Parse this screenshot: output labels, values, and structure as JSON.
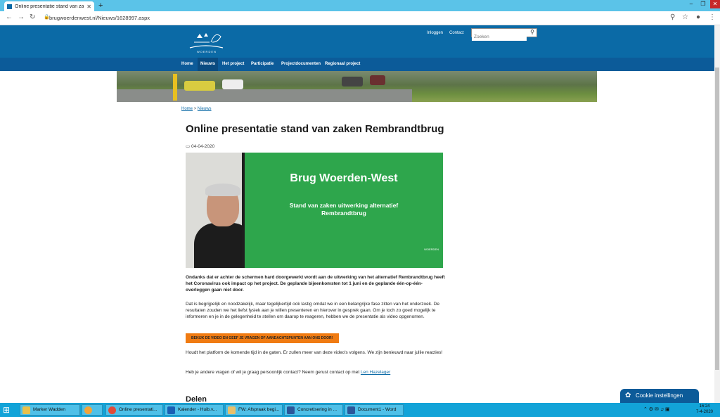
{
  "browser": {
    "tab_title": "Online presentatie stand van zaken",
    "url": "brugwoerdenwest.nl/Nieuws/1628997.aspx"
  },
  "header": {
    "logo_text": "WOERDEN",
    "login": "Inloggen",
    "contact": "Contact",
    "search_placeholder": "Zoeken"
  },
  "nav": [
    "Home",
    "Nieuws",
    "Het project",
    "Participatie",
    "Projectdocumenten",
    "Regionaal project"
  ],
  "breadcrumb": {
    "home": "Home",
    "sep": ">",
    "current": "Nieuws"
  },
  "article": {
    "title": "Online presentatie stand van zaken Rembrandtbrug",
    "date": "04-04-2020",
    "video": {
      "title": "Brug Woerden-West",
      "subtitle_1": "Stand van zaken uitwerking alternatief",
      "subtitle_2": "Rembrandtbrug",
      "logo": "WOERDEN"
    },
    "intro": "Ondanks dat er achter de schermen hard doorgewerkt wordt aan de uitwerking van het alternatief Rembrandtbrug heeft het Coronavirus ook impact op het project. De geplande bijeenkomsten tot 1 juni en de geplande één-op-één-overleggen gaan niet door.",
    "para2": "Dat is begrijpelijk en noodzakelijk, maar tegelijkertijd ook lastig omdat we in een belangrijke fase zitten van het onderzoek. De resultaten zouden we het liefst fysiek aan je willen presenteren en hierover in gesprek gaan. Om je toch zo goed mogelijk te informeren en je in de gelegenheid te stellen om daarop te reageren, hebben we de presentatie als video opgenomen.",
    "cta": "BEKIJK DE VIDEO EN GEEF JE VRAGEN OF AANDACHTSPUNTEN AAN ONS DOOR!",
    "para3": "Houdt het platform de komende tijd in de gaten. Er zullen meer van deze video's volgens. We zijn benieuwd naar jullie reacties!",
    "para4_text": "Heb je andere vragen of wil je graag persoonlijk contact? Neem gerust contact op met",
    "para4_link": "Len Hazelager",
    "share": "Delen"
  },
  "cookie": "Cookie instellingen",
  "taskbar": {
    "tasks": [
      "Marker Wadden",
      "",
      "Online presentati...",
      "Kalender - Huib.v...",
      "FW: Afspraak begi...",
      "Concretisering in ...",
      "Document1 - Word"
    ],
    "time": "16:24",
    "date": "7-4-2020"
  },
  "colors": {
    "brand": "#0b6aa6",
    "nav": "#0c5b99",
    "cta": "#f07b12",
    "taskbar": "#12a3d8"
  }
}
